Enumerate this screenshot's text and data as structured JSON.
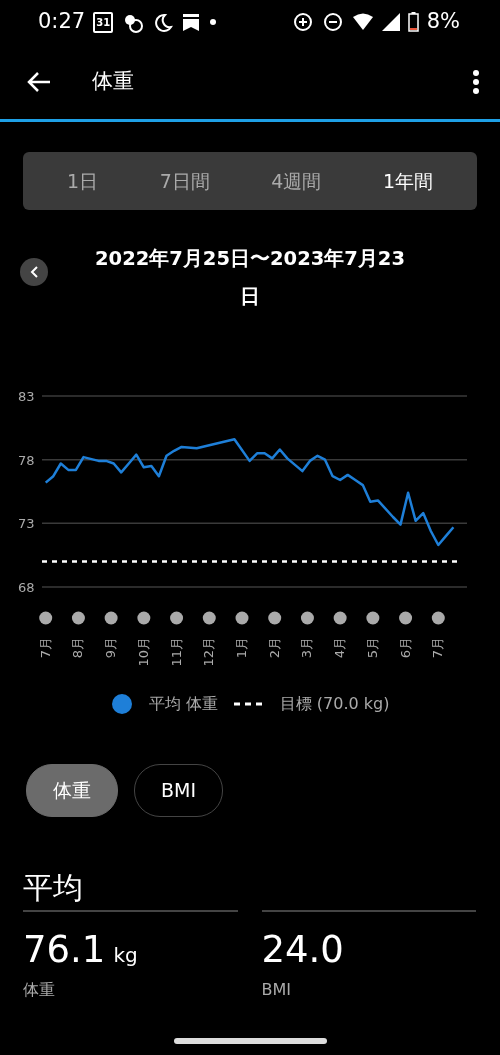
{
  "status_bar": {
    "time": "0:27",
    "calendar_day": "31",
    "battery": "8%"
  },
  "app_bar": {
    "title": "体重"
  },
  "range_tabs": [
    {
      "label": "1日",
      "selected": false
    },
    {
      "label": "7日間",
      "selected": false
    },
    {
      "label": "4週間",
      "selected": false
    },
    {
      "label": "1年間",
      "selected": true
    }
  ],
  "date_range": "2022年7月25日〜2023年7月23日",
  "chart": {
    "chart_data": {
      "type": "line",
      "ylim": [
        68,
        83
      ],
      "yticks": [
        68,
        73,
        78,
        83
      ],
      "categories": [
        "7月",
        null,
        null,
        null,
        "8月",
        null,
        null,
        null,
        null,
        "9月",
        null,
        null,
        null,
        "10月",
        null,
        null,
        null,
        "11月",
        null,
        null,
        null,
        null,
        "12月",
        null,
        null,
        null,
        "1月",
        null,
        null,
        null,
        "2月",
        null,
        null,
        null,
        null,
        "3月",
        null,
        null,
        null,
        "4月",
        null,
        null,
        null,
        "5月",
        null,
        null,
        null,
        null,
        "6月",
        null,
        null,
        null,
        "7月",
        null,
        null
      ],
      "series": [
        {
          "name": "平均 体重",
          "color": "#1e7fd8",
          "values": [
            76.2,
            76.7,
            77.7,
            77.2,
            77.2,
            78.2,
            null,
            77.9,
            77.9,
            77.7,
            77.0,
            77.7,
            78.4,
            77.4,
            77.5,
            76.7,
            78.3,
            78.7,
            79.0,
            null,
            78.9,
            null,
            null,
            null,
            null,
            79.6,
            null,
            77.9,
            78.5,
            78.5,
            78.1,
            78.8,
            78.1,
            null,
            77.1,
            77.9,
            78.3,
            78.0,
            76.7,
            76.4,
            76.8,
            76.4,
            76.0,
            74.7,
            74.8,
            null,
            73.5,
            72.9,
            75.4,
            73.2,
            73.8,
            72.4,
            71.3,
            72.0,
            72.7
          ]
        }
      ],
      "ref_lines": [
        {
          "axis": "y",
          "value": 70,
          "color": "#ffffff"
        }
      ]
    },
    "legend": [
      {
        "kind": "dot",
        "color": "#1e7fd8"
      },
      {
        "kind": "dashed",
        "label": "目標 (70.0 kg)",
        "color": "#ffffff"
      }
    ]
  },
  "metric_chips": [
    {
      "label": "体重",
      "selected": true
    },
    {
      "label": "BMI",
      "selected": false
    }
  ],
  "summary": {
    "heading": "平均",
    "stats": [
      {
        "value": "76.1",
        "unit": "kg",
        "label": "体重"
      },
      {
        "value": "24.0",
        "label": "BMI"
      }
    ]
  }
}
